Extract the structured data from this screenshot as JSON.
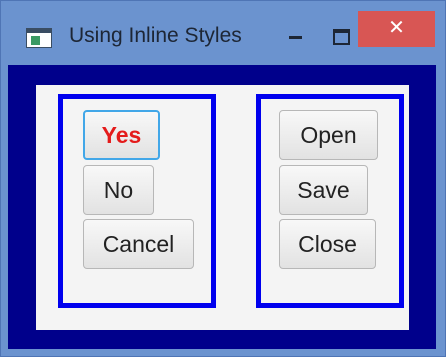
{
  "window": {
    "title": "Using Inline Styles",
    "close_glyph": "✕",
    "minimize_icon": "minimize-icon",
    "maximize_icon": "maximize-icon",
    "accent_color": "#6b93cf",
    "close_color": "#d85654",
    "frame_color": "#00008b",
    "group_border_color": "#0000ee"
  },
  "left_group": {
    "buttons": [
      "Yes",
      "No",
      "Cancel"
    ],
    "yes_text_color": "#e41b1b",
    "focused": "Yes"
  },
  "right_group": {
    "buttons": [
      "Open",
      "Save",
      "Close"
    ]
  }
}
